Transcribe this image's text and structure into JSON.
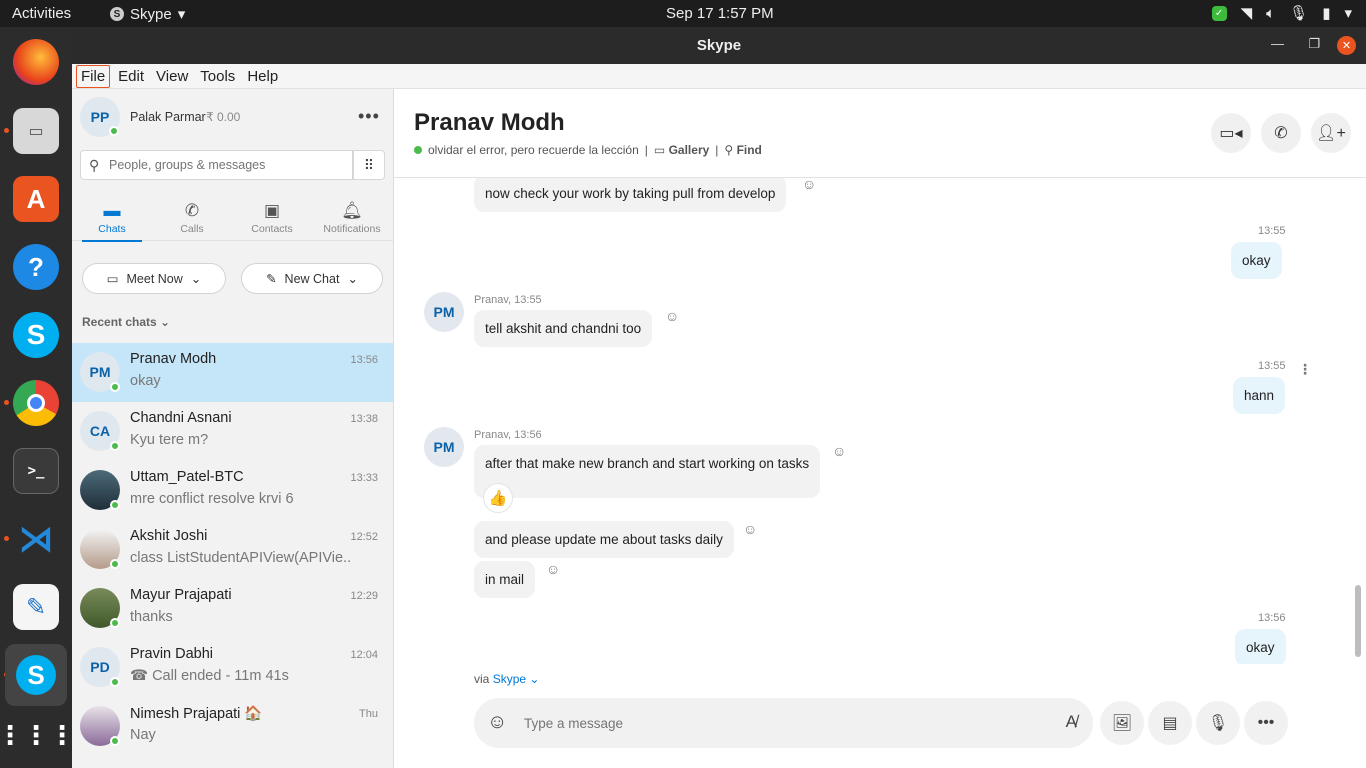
{
  "topbar": {
    "activities": "Activities",
    "app_name": "Skype",
    "datetime": "Sep 17  1:57 PM"
  },
  "window": {
    "title": "Skype"
  },
  "menu": [
    "File",
    "Edit",
    "View",
    "Tools",
    "Help"
  ],
  "profile": {
    "initials": "PP",
    "name": "Palak Parmar",
    "balance": "₹ 0.00"
  },
  "search": {
    "placeholder": "People, groups & messages"
  },
  "tabs": [
    "Chats",
    "Calls",
    "Contacts",
    "Notifications"
  ],
  "actions": {
    "meet_now": "Meet Now",
    "new_chat": "New Chat"
  },
  "recent_label": "Recent chats",
  "chats": [
    {
      "initials": "PM",
      "name": "Pranav Modh",
      "msg": "okay",
      "time": "13:56"
    },
    {
      "initials": "CA",
      "name": "Chandni Asnani",
      "msg": "Kyu tere m?",
      "time": "13:38"
    },
    {
      "initials": "",
      "name": "Uttam_Patel-BTC",
      "msg": "mre conflict resolve krvi 6",
      "time": "13:33"
    },
    {
      "initials": "",
      "name": "Akshit Joshi",
      "msg": "class ListStudentAPIView(APIVie...",
      "time": "12:52"
    },
    {
      "initials": "",
      "name": "Mayur Prajapati",
      "msg": "thanks",
      "time": "12:29"
    },
    {
      "initials": "PD",
      "name": "Pravin Dabhi",
      "msg": "☎ Call ended - 11m 41s",
      "time": "12:04"
    },
    {
      "initials": "",
      "name": "Nimesh Prajapati 🏠",
      "msg": "Nay",
      "time": "Thu"
    }
  ],
  "conversation": {
    "name": "Pranav Modh",
    "mood": "olvidar el error, pero recuerde la lección",
    "sep": "|",
    "gallery": "Gallery",
    "find": "Find",
    "messages": [
      {
        "text": "now check your work by taking pull from develop"
      },
      {
        "meta": "13:55",
        "text": "okay"
      },
      {
        "initials": "PM",
        "meta": "Pranav, 13:55",
        "text": "tell akshit and chandni too"
      },
      {
        "meta": "13:55",
        "text": "hann"
      },
      {
        "initials": "PM",
        "meta": "Pranav, 13:56",
        "text": "after that make new branch and start working on tasks"
      },
      {
        "text": "and please update me about tasks daily"
      },
      {
        "text": "in mail"
      },
      {
        "meta": "13:56",
        "text": "okay"
      }
    ]
  },
  "via": {
    "prefix": "via",
    "service": "Skype"
  },
  "composer": {
    "placeholder": "Type a message"
  }
}
